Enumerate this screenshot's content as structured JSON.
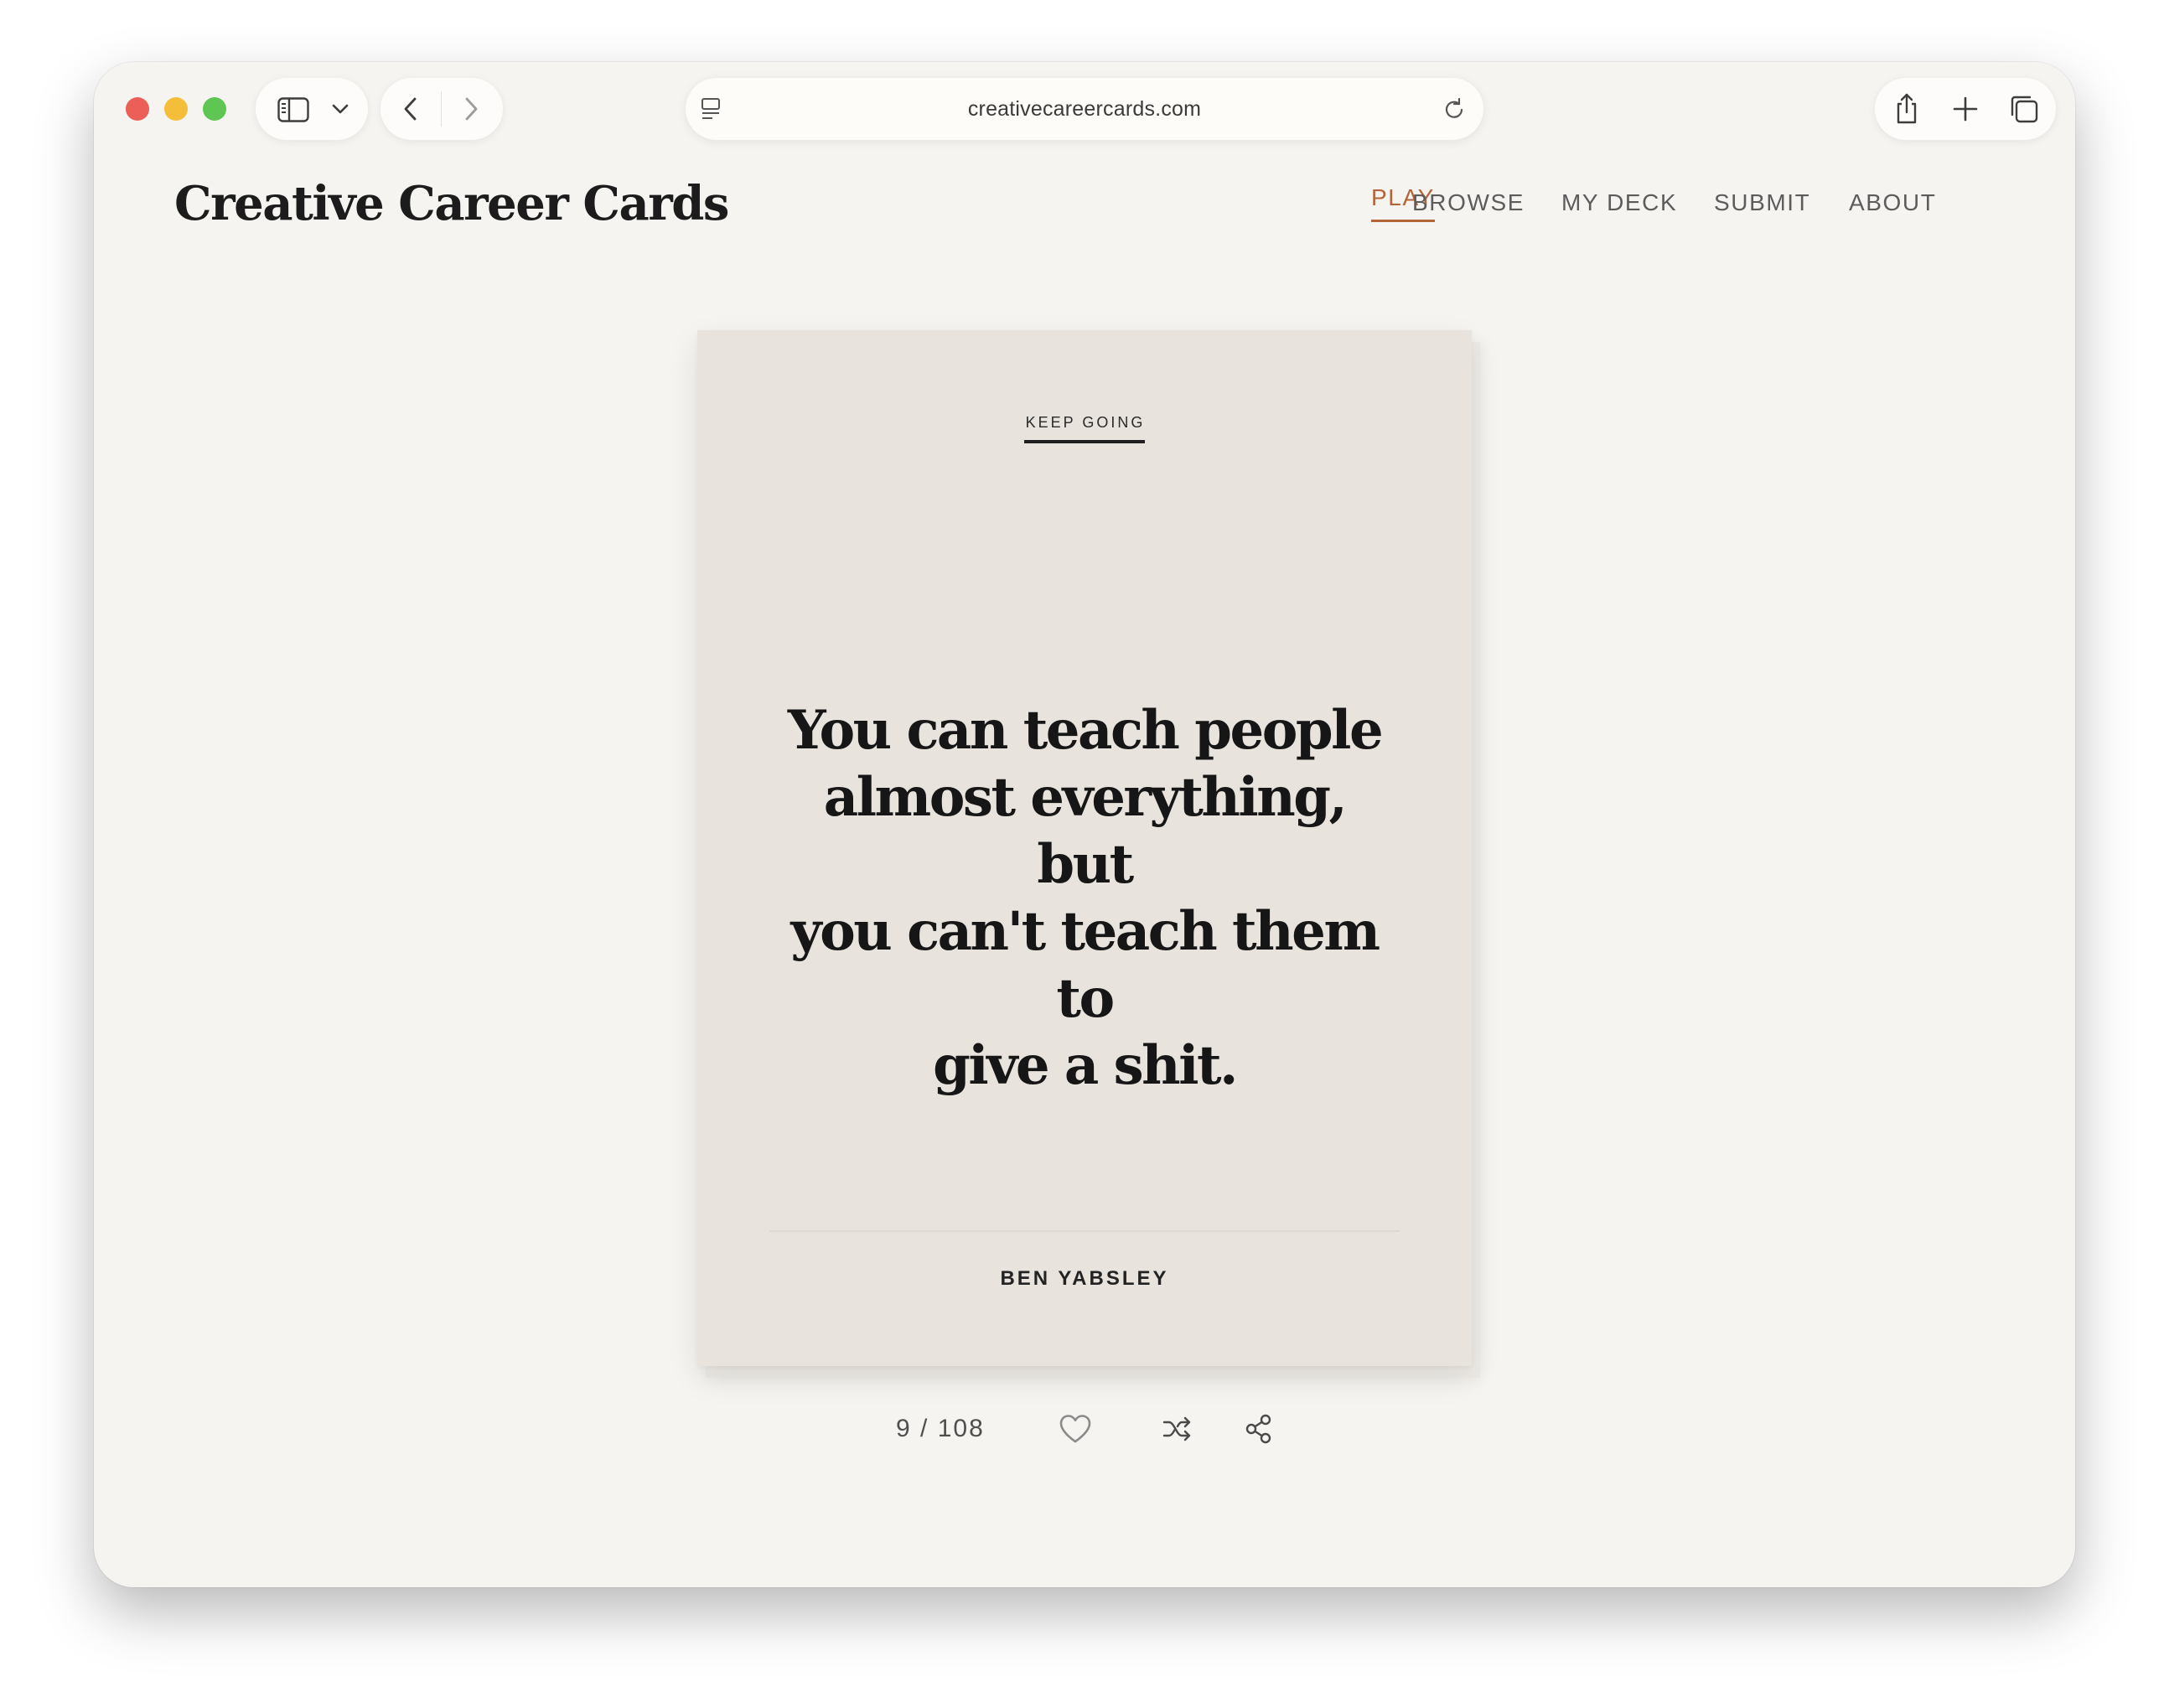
{
  "browser": {
    "url": "creativecareercards.com"
  },
  "site": {
    "title": "Creative Career Cards",
    "nav": [
      {
        "label": "PLAY",
        "active": true
      },
      {
        "label": "BROWSE",
        "active": false
      },
      {
        "label": "MY DECK",
        "active": false
      },
      {
        "label": "SUBMIT",
        "active": false
      },
      {
        "label": "ABOUT",
        "active": false
      }
    ]
  },
  "card": {
    "category": "KEEP GOING",
    "quote_lines": [
      "You can teach people",
      "almost everything, but",
      "you can't teach them to",
      "give a shit."
    ],
    "author": "BEN YABSLEY"
  },
  "controls": {
    "current": "9",
    "separator": "/",
    "total": "108"
  },
  "colors": {
    "accent": "#b3653a",
    "background": "#f6f4f0",
    "card": "#e8e3dc",
    "text": "#161616"
  },
  "icons": {
    "sidebar": "sidebar-icon",
    "chevron": "chevron-down-icon",
    "back": "back-arrow-icon",
    "forward": "forward-arrow-icon",
    "reader": "reader-icon",
    "reload": "reload-icon",
    "share": "share-icon",
    "new_tab": "plus-icon",
    "tabs": "tabs-overview-icon",
    "like": "heart-icon",
    "shuffle": "shuffle-icon",
    "share_card": "share-nodes-icon"
  }
}
